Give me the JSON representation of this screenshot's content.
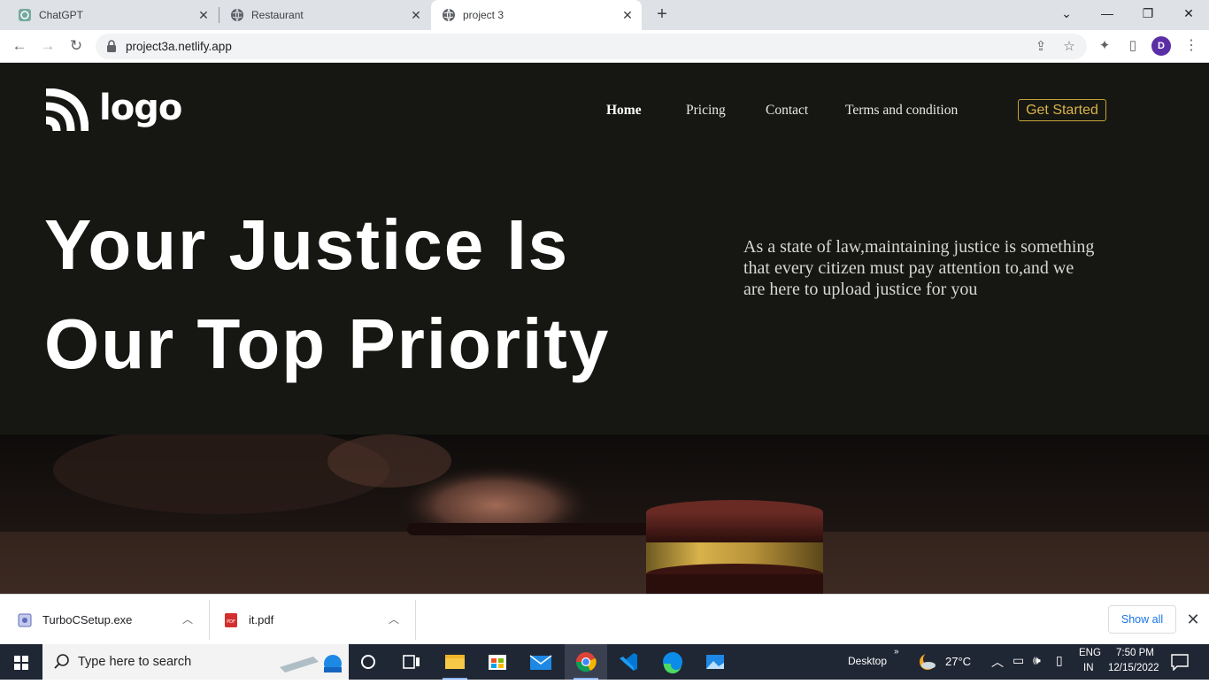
{
  "browser": {
    "tabs": [
      {
        "title": "ChatGPT",
        "active": false
      },
      {
        "title": "Restaurant",
        "active": false
      },
      {
        "title": "project 3",
        "active": true
      }
    ],
    "url": "project3a.netlify.app",
    "profile_initial": "D"
  },
  "site": {
    "logo_text": "logo",
    "nav": {
      "home": "Home",
      "pricing": "Pricing",
      "contact": "Contact",
      "terms": "Terms and condition"
    },
    "cta_label": "Get Started",
    "hero": {
      "title_line1": "Your Justice Is",
      "title_line2": "Our Top Priority",
      "text": "As a state of law,maintaining justice is something that every citizen must pay attention to,and we are here to upload justice for you"
    },
    "colors": {
      "background": "#161712",
      "accent": "#c8a23a"
    }
  },
  "downloads": {
    "items": [
      {
        "name": "TurboCSetup.exe",
        "icon": "installer-icon"
      },
      {
        "name": "it.pdf",
        "icon": "pdf-icon"
      }
    ],
    "show_all_label": "Show all"
  },
  "taskbar": {
    "search_placeholder": "Type here to search",
    "desktop_label": "Desktop",
    "weather": "27°C",
    "lang_line1": "ENG",
    "lang_line2": "IN",
    "time": "7:50 PM",
    "date": "12/15/2022"
  }
}
